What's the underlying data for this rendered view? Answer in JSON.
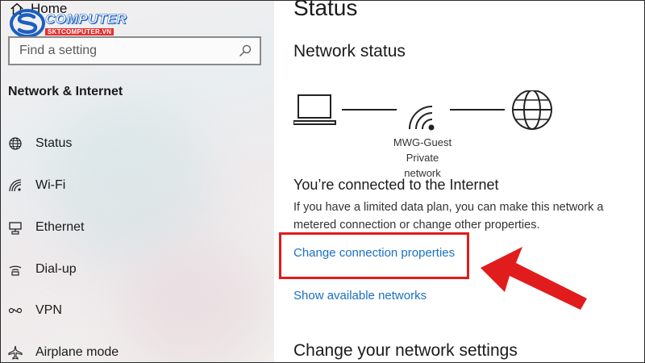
{
  "sidebar": {
    "home_label": "Home",
    "search_placeholder": "Find a setting",
    "section_title": "Network & Internet",
    "items": [
      {
        "label": "Status",
        "icon": "globe-icon"
      },
      {
        "label": "Wi-Fi",
        "icon": "wifi-icon"
      },
      {
        "label": "Ethernet",
        "icon": "ethernet-icon"
      },
      {
        "label": "Dial-up",
        "icon": "dialup-icon"
      },
      {
        "label": "VPN",
        "icon": "vpn-icon"
      },
      {
        "label": "Airplane mode",
        "icon": "airplane-icon"
      }
    ]
  },
  "logo": {
    "brand": "COMPUTER",
    "site": "SKTCOMPUTER.VN"
  },
  "main": {
    "title": "Status",
    "network_status_heading": "Network status",
    "network_name": "MWG-Guest",
    "network_type": "Private network",
    "connected_heading": "You’re connected to the Internet",
    "connected_desc": "If you have a limited data plan, you can make this network a metered connection or change other properties.",
    "change_connection_link": "Change connection properties",
    "show_networks_link": "Show available networks",
    "change_settings_heading": "Change your network settings"
  },
  "colors": {
    "accent_link": "#1a6fc4",
    "annotation_red": "#e11c1c",
    "logo_blue": "#1b5fbf"
  }
}
